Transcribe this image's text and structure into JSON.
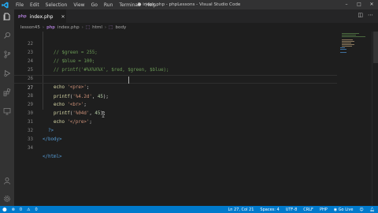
{
  "window": {
    "title": "● index.php - phpLessons - Visual Studio Code",
    "menu": [
      "File",
      "Edit",
      "Selection",
      "View",
      "Go",
      "Run",
      "Terminal",
      "Help"
    ]
  },
  "tab": {
    "label": "index.php",
    "icon": "php-icon"
  },
  "breadcrumb": {
    "items": [
      "lesson45",
      "index.php",
      "html",
      "body"
    ]
  },
  "editor": {
    "lines": [
      {
        "num": "22",
        "text": "    // $green = 255;"
      },
      {
        "num": "23",
        "text": "    // $blue = 100;"
      },
      {
        "num": "24",
        "text": "    // printf('#%X%X%X', $red, $green, $blue);"
      },
      {
        "num": "25",
        "text": ""
      },
      {
        "num": "26",
        "text": "    echo '<pre>';"
      },
      {
        "num": "27",
        "text": "    printf('%4.2d', 45);"
      },
      {
        "num": "28",
        "text": "    echo '<br>';"
      },
      {
        "num": "29",
        "text": "    printf('%04d', 45);"
      },
      {
        "num": "30",
        "text": "    echo '</pre>';"
      },
      {
        "num": "31",
        "text": "  ?>"
      },
      {
        "num": "32",
        "text": "</body>"
      },
      {
        "num": "33",
        "text": ""
      },
      {
        "num": "34",
        "text": "</html>"
      }
    ],
    "active_line": "27"
  },
  "statusbar": {
    "errors": "0",
    "warnings": "0",
    "position": "Ln 27, Col 21",
    "spaces": "Spaces: 4",
    "encoding": "UTF-8",
    "eol": "CRLF",
    "language": "PHP",
    "golive": "Go Live"
  },
  "colors": {
    "accent": "#007acc",
    "editor_bg": "#1e1e1e",
    "comment": "#6a9955",
    "function": "#dcdcaa",
    "string": "#ce9178",
    "number": "#b5cea8",
    "tag": "#569cd6"
  }
}
